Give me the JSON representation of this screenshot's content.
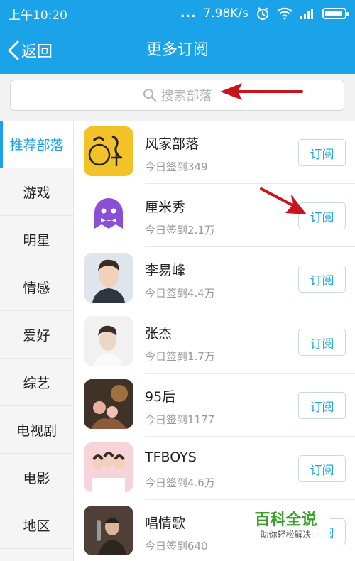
{
  "status_bar": {
    "time": "上午10:20",
    "dots": "...",
    "net_speed": "7.98K/s",
    "battery_level": 0.9
  },
  "nav": {
    "back_label": "返回",
    "title": "更多订阅"
  },
  "search": {
    "placeholder": "搜索部落"
  },
  "sidebar": {
    "items": [
      {
        "label": "推荐部落",
        "active": true
      },
      {
        "label": "游戏"
      },
      {
        "label": "明星"
      },
      {
        "label": "情感"
      },
      {
        "label": "爱好"
      },
      {
        "label": "综艺"
      },
      {
        "label": "电视剧"
      },
      {
        "label": "电影"
      },
      {
        "label": "地区"
      }
    ]
  },
  "tribes": [
    {
      "name": "风家部落",
      "checkins": "今日签到349",
      "button": "订阅"
    },
    {
      "name": "厘米秀",
      "checkins": "今日签到2.1万",
      "button": "订阅"
    },
    {
      "name": "李易峰",
      "checkins": "今日签到4.4万",
      "button": "订阅"
    },
    {
      "name": "张杰",
      "checkins": "今日签到1.7万",
      "button": "订阅"
    },
    {
      "name": "95后",
      "checkins": "今日签到1177",
      "button": "订阅"
    },
    {
      "name": "TFBOYS",
      "checkins": "今日签到4.6万",
      "button": "订阅"
    },
    {
      "name": "唱情歌",
      "checkins": "今日签到640",
      "button": "订阅"
    }
  ],
  "watermark": {
    "title": "百科全说",
    "subtitle": "助你轻松解决"
  },
  "colors": {
    "accent": "#1aa3e8",
    "annotation_arrow": "#c8141c"
  }
}
